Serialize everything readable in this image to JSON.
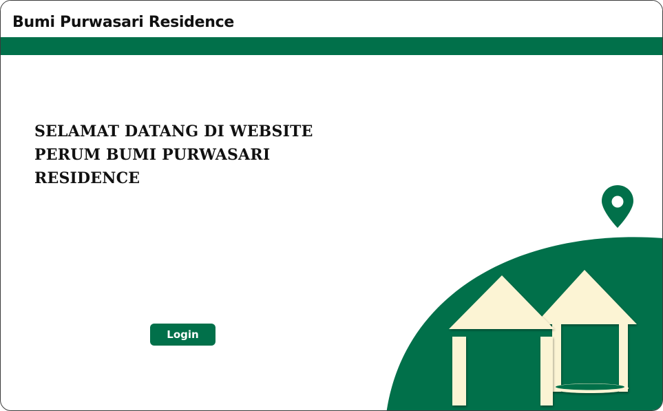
{
  "header": {
    "title": "Bumi Purwasari Residence"
  },
  "hero": {
    "heading_lines": [
      "SELAMAT DATANG  DI WEBSITE",
      "PERUM BUMI PURWASARI",
      "RESIDENCE"
    ]
  },
  "actions": {
    "login_label": "Login"
  },
  "icons": {
    "location": "location-pin-icon",
    "houses": "houses-illustration"
  },
  "colors": {
    "brand_green": "#01704a",
    "cream": "#fcf4d4",
    "text": "#111111",
    "background": "#ffffff"
  }
}
